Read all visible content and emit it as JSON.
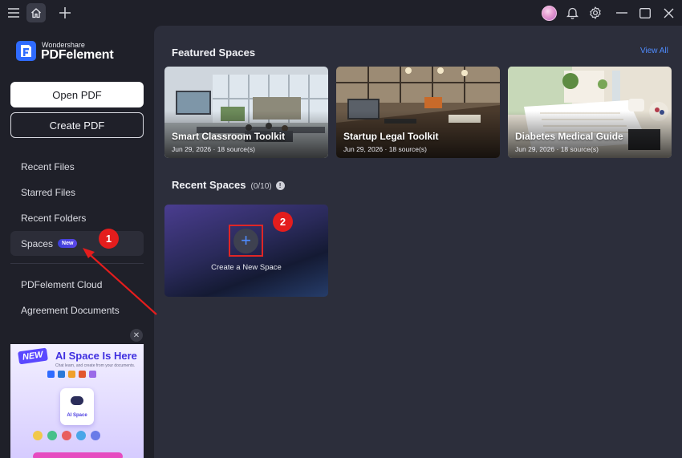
{
  "titlebar": {
    "icons": [
      "menu-icon",
      "home-icon",
      "plus-icon",
      "avatar",
      "bell-icon",
      "gear-icon",
      "minimize-icon",
      "maximize-icon",
      "close-icon"
    ]
  },
  "sidebar": {
    "logo_small": "Wondershare",
    "logo_big": "PDFelement",
    "open_pdf": "Open PDF",
    "create_pdf": "Create PDF",
    "items": [
      {
        "label": "Recent Files"
      },
      {
        "label": "Starred Files"
      },
      {
        "label": "Recent Folders"
      },
      {
        "label": "Spaces",
        "badge": "New",
        "active": true
      },
      {
        "label": "PDFelement Cloud"
      },
      {
        "label": "Agreement Documents"
      }
    ]
  },
  "ad": {
    "badge": "NEW",
    "title": "AI Space Is Here",
    "subtitle": "Chat learn, and create from your documents.",
    "card_label": "AI Space"
  },
  "featured": {
    "title": "Featured Spaces",
    "view_all": "View All",
    "cards": [
      {
        "title": "Smart Classroom Toolkit",
        "meta": "Jun 29, 2026 · 18 source(s)"
      },
      {
        "title": "Startup Legal Toolkit",
        "meta": "Jun 29, 2026 · 18 source(s)"
      },
      {
        "title": "Diabetes Medical Guide",
        "meta": "Jun 29, 2026 · 18 source(s)"
      }
    ]
  },
  "recent": {
    "title": "Recent Spaces",
    "count": "(0/10)",
    "info": "!",
    "create_label": "Create a New Space"
  },
  "annotations": {
    "step1": "1",
    "step2": "2",
    "color": "#e41d1d"
  },
  "colors": {
    "accent": "#4f8cff",
    "brand": "#2f6bff",
    "sidebar_bg": "#1f2029",
    "main_bg": "#2c2e3b"
  }
}
